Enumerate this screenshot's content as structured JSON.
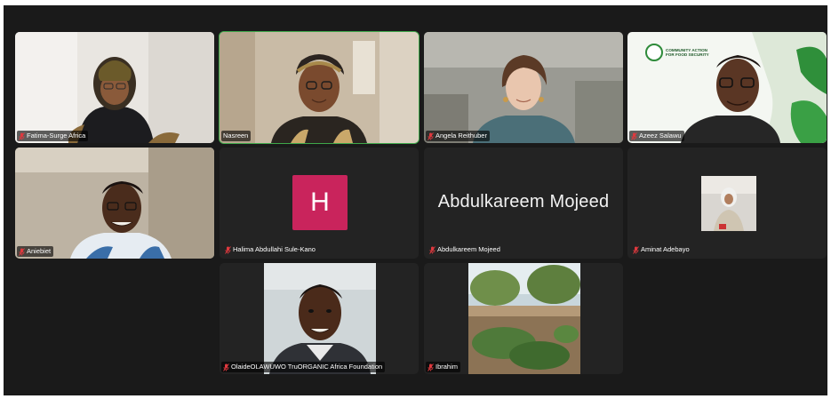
{
  "meeting": {
    "participants": [
      {
        "name": "Fatima-Surge Africa",
        "muted": true
      },
      {
        "name": "Nasreen",
        "muted": false,
        "active_speaker": true
      },
      {
        "name": "Angela Reithuber",
        "muted": true
      },
      {
        "name": "Azeez Salawu",
        "muted": true,
        "background_text": "COMMUNITY ACTION FOR FOOD SECURITY"
      },
      {
        "name": "Aniebiet",
        "muted": true
      },
      {
        "name": "Halima Abdullahi Sule-Kano",
        "muted": true,
        "avatar_initial": "H"
      },
      {
        "name": "Abdulkareem Mojeed",
        "muted": true,
        "display_name": "Abdulkareem Mojeed"
      },
      {
        "name": "Aminat Adebayo",
        "muted": true
      },
      {
        "name": "OlaideOLAWUWO TruORGANIC Africa Foundation",
        "muted": true
      },
      {
        "name": "Ibrahim",
        "muted": true
      }
    ]
  },
  "colors": {
    "active_speaker_border": "#3ea74a",
    "muted_icon": "#e0393e",
    "avatar_bg": "#c9245c",
    "tile_bg": "#232323"
  },
  "icons": {
    "muted": "mic-muted-icon"
  }
}
